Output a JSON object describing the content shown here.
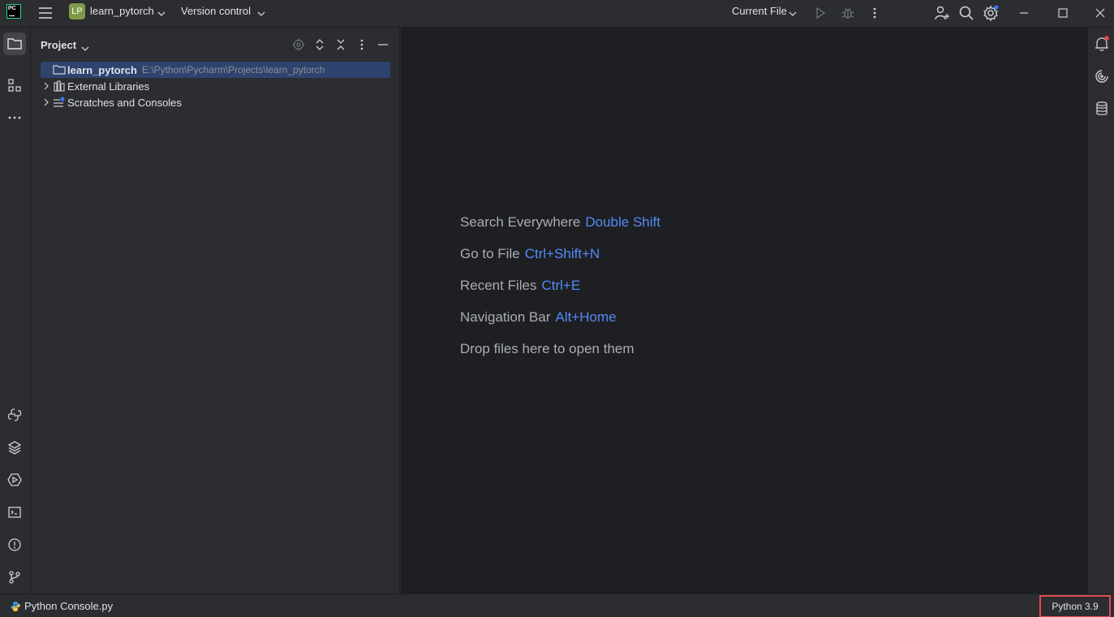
{
  "titlebar": {
    "app_logo_text": "PC",
    "project_badge": "LP",
    "project_name": "learn_pytorch",
    "vcs_label": "Version control",
    "run_config": "Current File",
    "icons": [
      "main-menu-icon",
      "run-icon",
      "debug-icon",
      "more-icon",
      "add-user-icon",
      "search-icon",
      "settings-icon",
      "minimize-icon",
      "maximize-icon",
      "close-icon"
    ]
  },
  "left_stripe": {
    "icons": [
      "project-folder-icon",
      "structure-icon",
      "more-tools-icon",
      "python-packages-icon",
      "layers-icon",
      "services-icon",
      "terminal-icon",
      "problems-icon",
      "git-icon"
    ]
  },
  "project_panel": {
    "title": "Project",
    "tree": [
      {
        "label": "learn_pytorch",
        "path": "E:\\Python\\Pycharm\\Projects\\learn_pytorch",
        "icon": "folder-icon",
        "selected": true
      },
      {
        "label": "External Libraries",
        "icon": "library-icon"
      },
      {
        "label": "Scratches and Consoles",
        "icon": "scratches-icon"
      }
    ]
  },
  "editor": {
    "hints": [
      {
        "text": "Search Everywhere",
        "key": "Double Shift"
      },
      {
        "text": "Go to File",
        "key": "Ctrl+Shift+N"
      },
      {
        "text": "Recent Files",
        "key": "Ctrl+E"
      },
      {
        "text": "Navigation Bar",
        "key": "Alt+Home"
      },
      {
        "text": "Drop files here to open them",
        "key": ""
      }
    ]
  },
  "right_stripe": {
    "icons": [
      "notifications-icon",
      "ai-assistant-icon",
      "database-icon"
    ]
  },
  "statusbar": {
    "file": "Python Console.py",
    "interpreter": "Python 3.9"
  },
  "colors": {
    "accent_link": "#548af7",
    "selection": "#2e436e",
    "highlight_box": "#e5494d",
    "project_badge": "#7f9b47"
  }
}
